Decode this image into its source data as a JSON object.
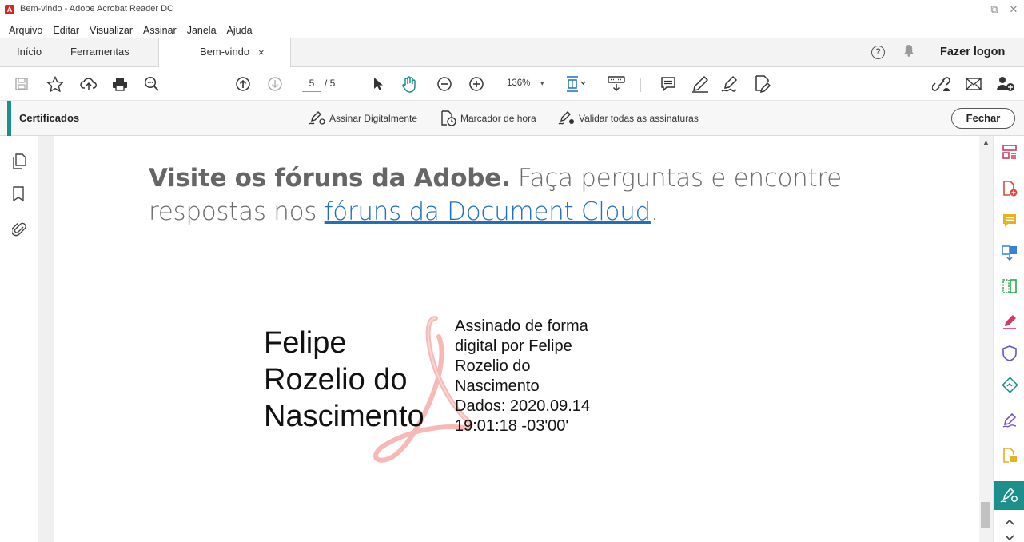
{
  "window": {
    "title": "Bem-vindo - Adobe Acrobat Reader DC",
    "app_icon": "acrobat-icon",
    "controls": [
      "minimize",
      "restore",
      "close"
    ],
    "minimize_glyph": "—",
    "restore_glyph": "⧉",
    "close_glyph": "✕"
  },
  "menu": [
    "Arquivo",
    "Editar",
    "Visualizar",
    "Assinar",
    "Janela",
    "Ajuda"
  ],
  "tabs": {
    "home": "Início",
    "tools": "Ferramentas",
    "active": "Bem-vindo",
    "close_glyph": "×"
  },
  "header": {
    "help_glyph": "?",
    "logon": "Fazer logon"
  },
  "toolbar": {
    "current_page": "5",
    "page_total": "/ 5",
    "zoom": "136%",
    "zoom_caret": "▾",
    "icons": [
      "save-icon",
      "bookmark-star-icon",
      "upload-cloud-icon",
      "print-icon",
      "search-zoom-icon",
      "page-up-icon",
      "page-down-icon",
      "select-arrow-icon",
      "hand-tool-icon",
      "zoom-out-icon",
      "zoom-in-icon",
      "fit-page-icon",
      "keyboard-scroll-icon",
      "comment-icon",
      "highlight-pen-icon",
      "sign-pen-icon",
      "fill-sign-icon",
      "share-link-icon",
      "email-icon",
      "add-user-icon"
    ]
  },
  "certificates": {
    "title": "Certificados",
    "actions": [
      "Assinar Digitalmente",
      "Marcador de hora",
      "Validar todas as assinaturas"
    ],
    "close": "Fechar"
  },
  "document": {
    "visit_bold": "Visite os fóruns da Adobe.",
    "visit_text": " Faça perguntas e encontre respostas nos ",
    "visit_link": "fóruns da Document Cloud",
    "visit_end": ".",
    "signature": {
      "name_line1": "Felipe",
      "name_line2": "Rozelio do",
      "name_line3": "Nascimento",
      "detail": "Assinado de forma\ndigital por Felipe\nRozelio do\nNascimento\nDados: 2020.09.14\n19:01:18 -03'00'"
    }
  },
  "colors": {
    "accent": "#1b8f8a",
    "link": "#1f6fbf",
    "acrobat_red": "#d7281d"
  }
}
